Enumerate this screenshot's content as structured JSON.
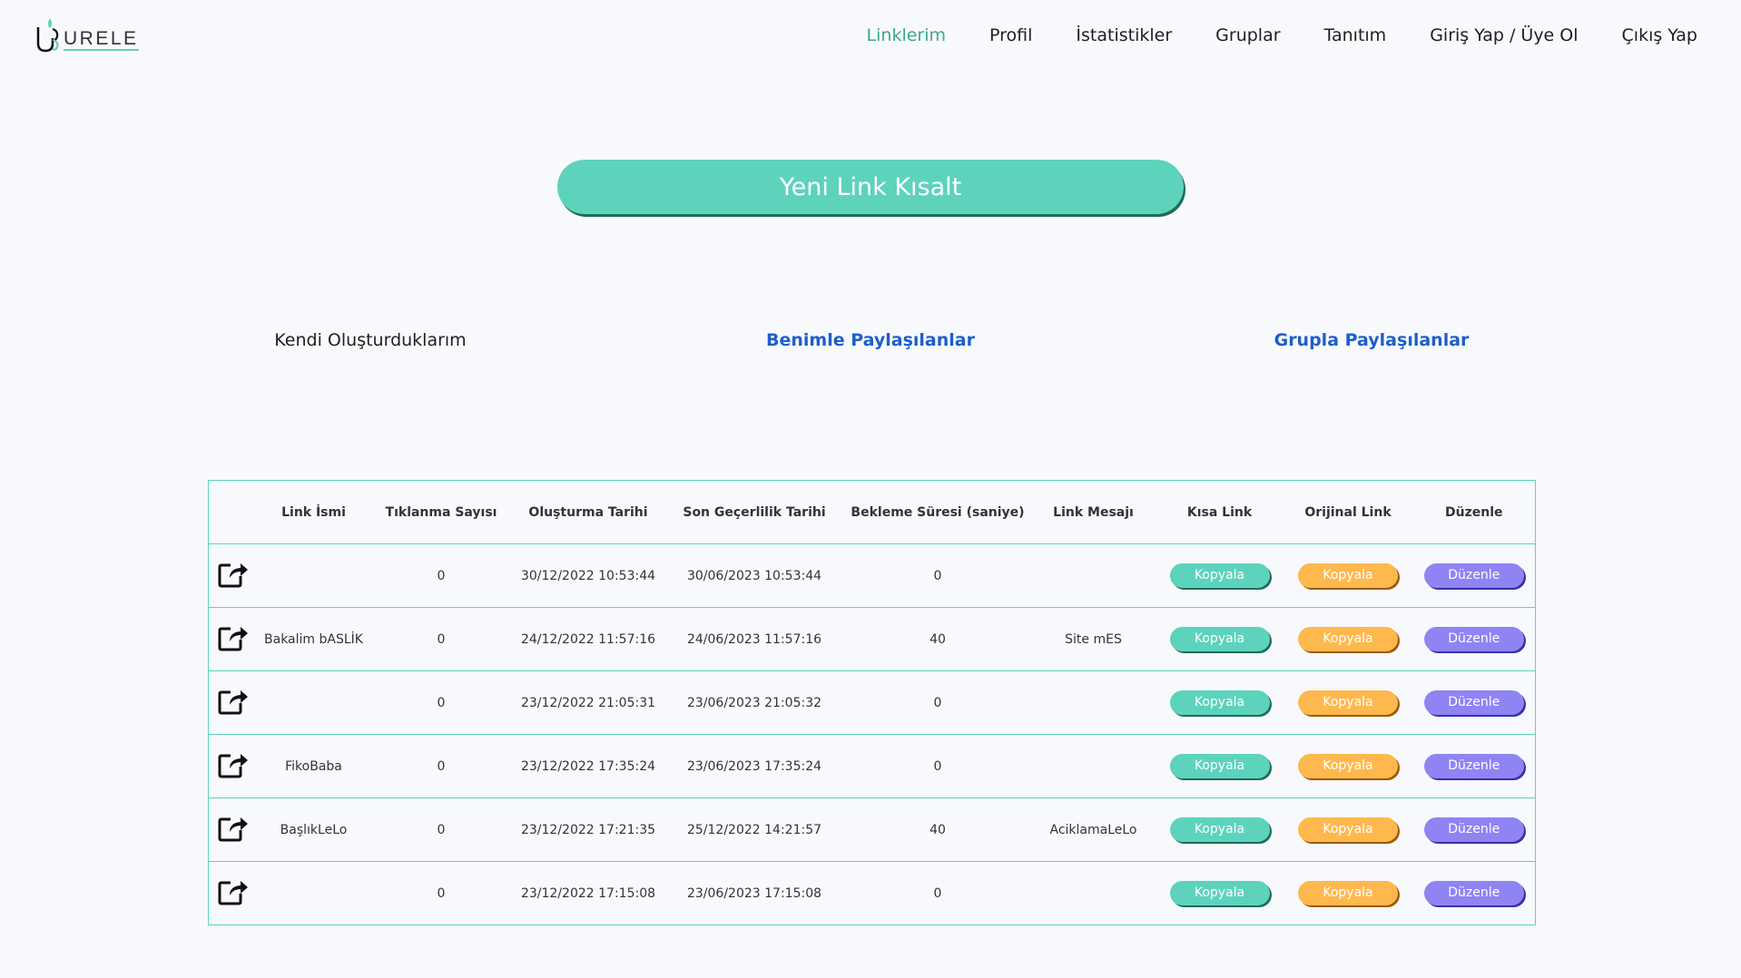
{
  "brand": {
    "logo_text": "URELE"
  },
  "nav": {
    "items": [
      {
        "label": "Linklerim",
        "active": true
      },
      {
        "label": "Profil"
      },
      {
        "label": "İstatistikler"
      },
      {
        "label": "Gruplar"
      },
      {
        "label": "Tanıtım"
      },
      {
        "label": "Giriş Yap / Üye Ol"
      },
      {
        "label": "Çıkış Yap"
      }
    ]
  },
  "cta": {
    "label": "Yeni Link Kısalt"
  },
  "tabs": [
    {
      "label": "Kendi Oluşturduklarım"
    },
    {
      "label": "Benimle Paylaşılanlar"
    },
    {
      "label": "Grupla Paylaşılanlar"
    }
  ],
  "table": {
    "headers": [
      "",
      "Link İsmi",
      "Tıklanma Sayısı",
      "Oluşturma Tarihi",
      "Son Geçerlilik Tarihi",
      "Bekleme Süresi (saniye)",
      "Link Mesajı",
      "Kısa Link",
      "Orijinal Link",
      "Düzenle"
    ],
    "copy_label": "Kopyala",
    "edit_label": "Düzenle",
    "rows": [
      {
        "name": "",
        "clicks": "0",
        "created": "30/12/2022 10:53:44",
        "expires": "30/06/2023 10:53:44",
        "wait": "0",
        "message": ""
      },
      {
        "name": "Bakalim bASLİK",
        "clicks": "0",
        "created": "24/12/2022 11:57:16",
        "expires": "24/06/2023 11:57:16",
        "wait": "40",
        "message": "Site mES"
      },
      {
        "name": "",
        "clicks": "0",
        "created": "23/12/2022 21:05:31",
        "expires": "23/06/2023 21:05:32",
        "wait": "0",
        "message": ""
      },
      {
        "name": "FikoBaba",
        "clicks": "0",
        "created": "23/12/2022 17:35:24",
        "expires": "23/06/2023 17:35:24",
        "wait": "0",
        "message": ""
      },
      {
        "name": "BaşlıkLeLo",
        "clicks": "0",
        "created": "23/12/2022 17:21:35",
        "expires": "25/12/2022 14:21:57",
        "wait": "40",
        "message": "AciklamaLeLo"
      },
      {
        "name": "",
        "clicks": "0",
        "created": "23/12/2022 17:15:08",
        "expires": "23/06/2023 17:15:08",
        "wait": "0",
        "message": ""
      }
    ]
  },
  "colors": {
    "accent_teal": "#5dd3bc",
    "accent_orange": "#ffb84d",
    "accent_purple": "#8e84f4",
    "link_blue": "#1d5fc9",
    "nav_active": "#3aa88f"
  }
}
